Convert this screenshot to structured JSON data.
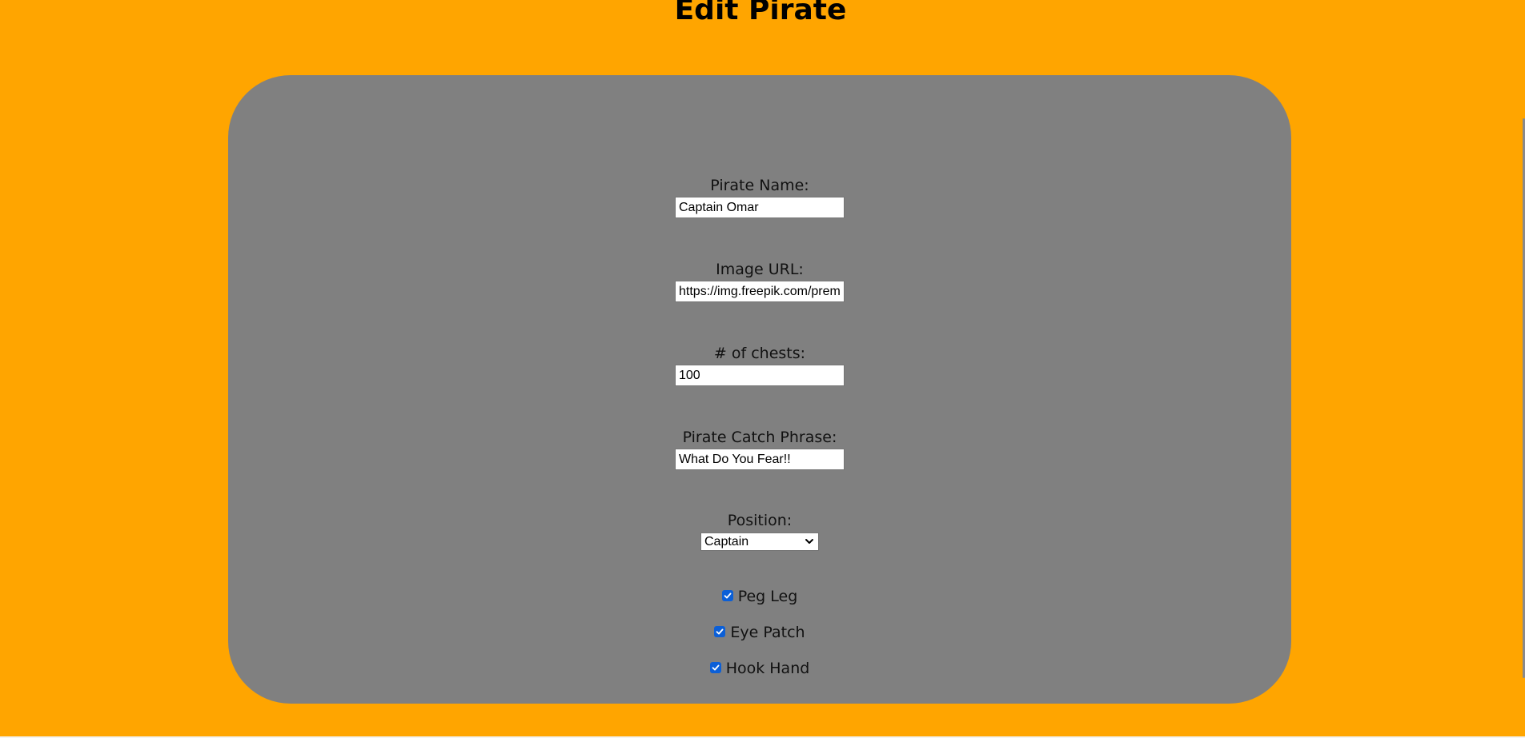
{
  "page": {
    "title": "Edit Pirate"
  },
  "form": {
    "pirate_name": {
      "label": "Pirate Name:",
      "value": "Captain Omar"
    },
    "image_url": {
      "label": "Image URL:",
      "value": "https://img.freepik.com/premium-vector/pirate"
    },
    "chests": {
      "label": "# of chests:",
      "value": "100"
    },
    "catch_phrase": {
      "label": "Pirate Catch Phrase:",
      "value": "What Do You Fear!!"
    },
    "position": {
      "label": "Position:",
      "selected": "Captain"
    },
    "checkboxes": [
      {
        "label": "Peg Leg",
        "checked": true
      },
      {
        "label": "Eye Patch",
        "checked": true
      },
      {
        "label": "Hook Hand",
        "checked": true
      }
    ]
  },
  "colors": {
    "background": "#ffa500",
    "card": "#808080",
    "checkbox": "#0b5fd7"
  }
}
